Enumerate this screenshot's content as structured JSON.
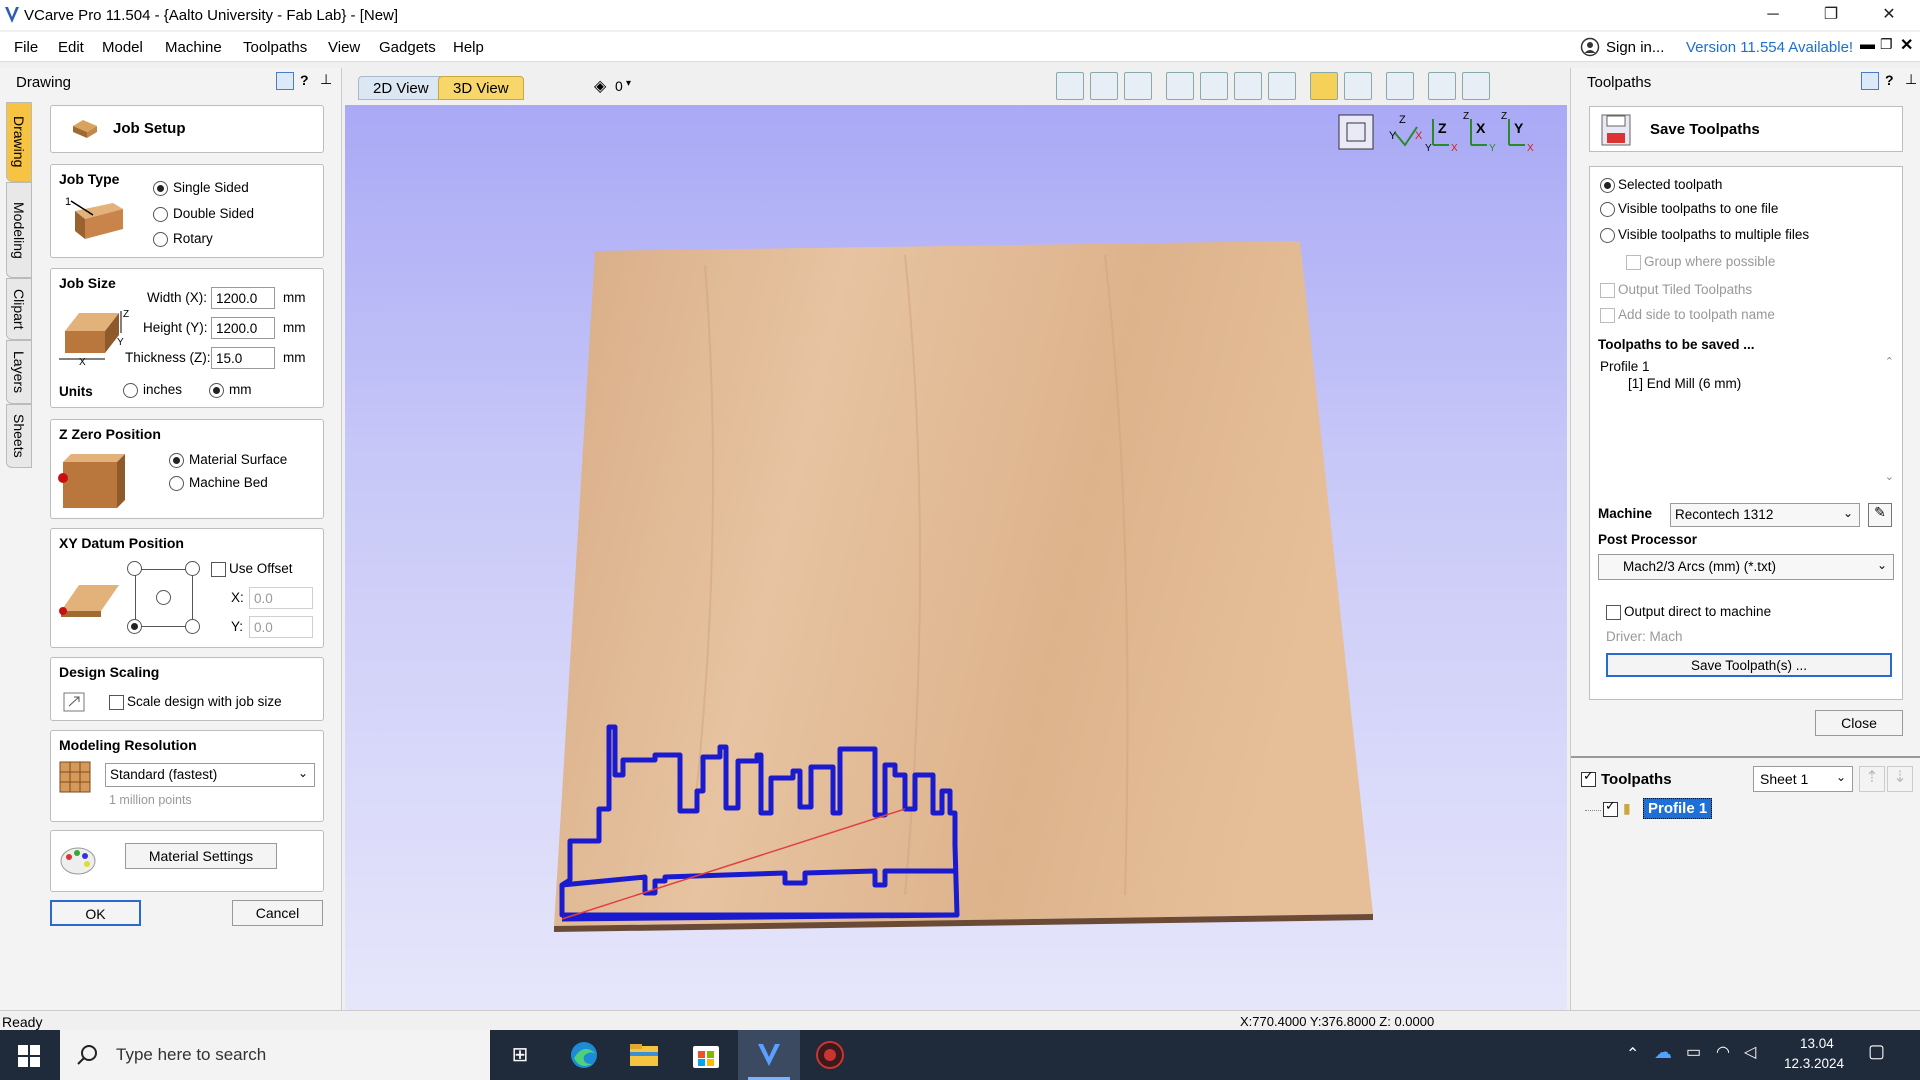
{
  "window": {
    "title": "VCarve Pro 11.504 - {Aalto University - Fab Lab} - [New]",
    "controls": [
      "─",
      "❐",
      "✕"
    ]
  },
  "menu": {
    "items": [
      "File",
      "Edit",
      "Model",
      "Machine",
      "Toolpaths",
      "View",
      "Gadgets",
      "Help"
    ],
    "sign_in": "Sign in...",
    "version_notice": "Version 11.554 Available!"
  },
  "left_panel": {
    "header": "Drawing",
    "vertical_tabs": [
      "Drawing",
      "Modeling",
      "Clipart",
      "Layers",
      "Sheets"
    ],
    "job_setup_title": "Job Setup",
    "job_type": {
      "title": "Job Type",
      "options": [
        "Single Sided",
        "Double Sided",
        "Rotary"
      ],
      "selected": "Single Sided"
    },
    "job_size": {
      "title": "Job Size",
      "width_label": "Width (X):",
      "width_value": "1200.0",
      "height_label": "Height (Y):",
      "height_value": "1200.0",
      "thickness_label": "Thickness (Z):",
      "thickness_value": "15.0",
      "unit": "mm",
      "units_label": "Units",
      "units_options": [
        "inches",
        "mm"
      ],
      "units_selected": "mm"
    },
    "z_zero": {
      "title": "Z Zero Position",
      "options": [
        "Material Surface",
        "Machine Bed"
      ],
      "selected": "Material Surface"
    },
    "xy_datum": {
      "title": "XY Datum Position",
      "use_offset_label": "Use Offset",
      "x_label": "X:",
      "x_value": "0.0",
      "y_label": "Y:",
      "y_value": "0.0"
    },
    "design_scaling": {
      "title": "Design Scaling",
      "checkbox_label": "Scale design with job size"
    },
    "modeling_resolution": {
      "title": "Modeling Resolution",
      "selected": "Standard (fastest)",
      "hint": "1 million points"
    },
    "material_settings_label": "Material Settings",
    "ok_label": "OK",
    "cancel_label": "Cancel"
  },
  "view": {
    "tabs": [
      "2D View",
      "3D View"
    ],
    "active_tab": "3D View",
    "shading_value": "0",
    "axis_labels": [
      "Z",
      "Y",
      "X",
      "Z",
      "X",
      "Y",
      "Z",
      "X",
      "Y",
      "Z",
      "Y",
      "X"
    ],
    "sheet_color": "#dcb48d",
    "toolpath_color": "#1a1acf"
  },
  "right_panel": {
    "header": "Toolpaths",
    "save_title": "Save Toolpaths",
    "save_options": [
      "Selected toolpath",
      "Visible toolpaths to one file",
      "Visible toolpaths to multiple files"
    ],
    "save_selected": "Selected toolpath",
    "group_label": "Group where possible",
    "output_tiled_label": "Output Tiled Toolpaths",
    "add_side_label": "Add side to toolpath name",
    "to_be_saved_title": "Toolpaths to be saved ...",
    "to_be_saved_items": [
      "Profile 1",
      "[1] End Mill (6 mm)"
    ],
    "machine_label": "Machine",
    "machine_value": "Recontech 1312",
    "post_label": "Post Processor",
    "post_value": "Mach2/3 Arcs (mm) (*.txt)",
    "output_direct_label": "Output direct to machine",
    "driver_label": "Driver: Mach",
    "save_button": "Save Toolpath(s) ...",
    "close_button": "Close",
    "toolpaths_list_title": "Toolpaths",
    "sheet_value": "Sheet 1",
    "toolpath_item": "Profile 1"
  },
  "status": {
    "text": "Ready",
    "coords": "X:770.4000 Y:376.8000 Z: 0.0000"
  },
  "taskbar": {
    "search_placeholder": "Type here to search",
    "time": "13.04",
    "date": "12.3.2024"
  }
}
